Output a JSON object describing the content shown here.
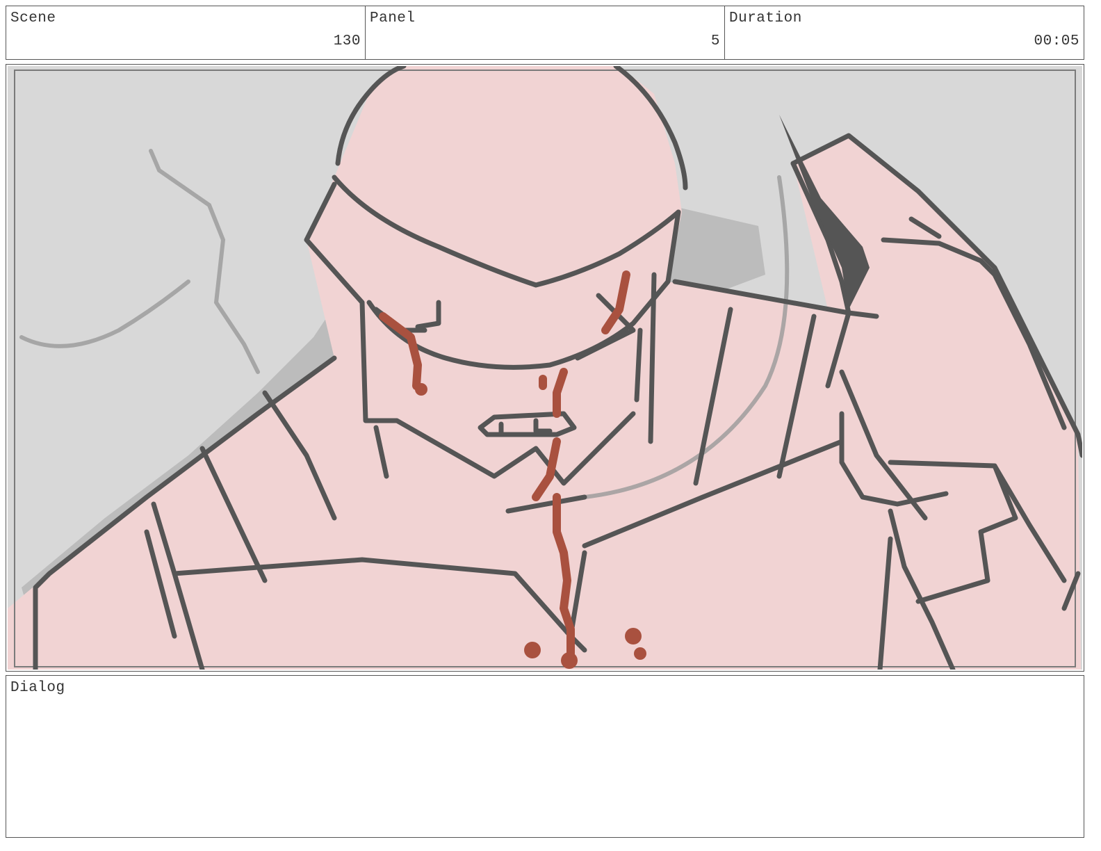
{
  "header": {
    "scene": {
      "label": "Scene",
      "value": "130"
    },
    "panel": {
      "label": "Panel",
      "value": "5"
    },
    "duration": {
      "label": "Duration",
      "value": "00:05"
    }
  },
  "dialog": {
    "label": "Dialog"
  },
  "artwork": {
    "name": "storyboard-sketch",
    "colors": {
      "background": "#d8d8d8",
      "skin": "#f1d3d3",
      "shadow": "#bcbcbc",
      "line": "#555555",
      "blood": "#a9513f"
    }
  }
}
